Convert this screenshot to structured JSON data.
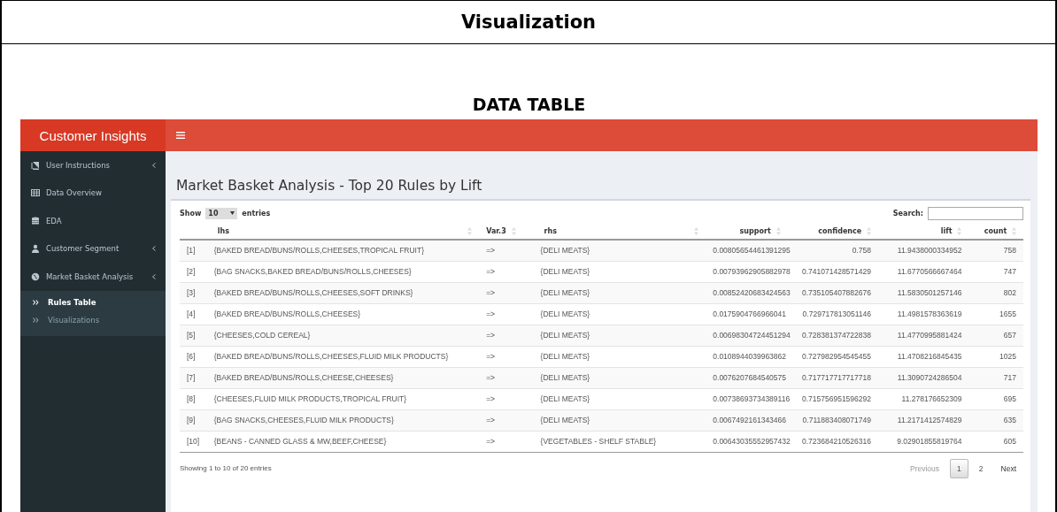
{
  "document": {
    "heading": "Visualization",
    "subheading": "DATA TABLE"
  },
  "app": {
    "brand": "Customer Insights",
    "sidebar": [
      {
        "label": "User Instructions",
        "expandable": true
      },
      {
        "label": "Data Overview",
        "expandable": false
      },
      {
        "label": "EDA",
        "expandable": false
      },
      {
        "label": "Customer Segment",
        "expandable": true
      },
      {
        "label": "Market Basket Analysis",
        "expandable": true,
        "children": [
          {
            "label": "Rules Table",
            "selected": true
          },
          {
            "label": "Visualizations",
            "selected": false
          }
        ]
      }
    ],
    "page_title": "Market Basket Analysis - Top 20 Rules by Lift",
    "length_menu": {
      "before": "Show",
      "value": "10",
      "after": "entries"
    },
    "search": {
      "label": "Search:"
    },
    "columns": [
      null,
      "lhs",
      "Var.3",
      "rhs",
      "support",
      "confidence",
      "lift",
      "count"
    ],
    "rows": [
      [
        "[1]",
        "{BAKED BREAD/BUNS/ROLLS,CHEESES,TROPICAL FRUIT}",
        "=>",
        "{DELI MEATS}",
        "0.00805654461391295",
        "0.758",
        "11.9438000334952",
        "758"
      ],
      [
        "[2]",
        "{BAG SNACKS,BAKED BREAD/BUNS/ROLLS,CHEESES}",
        "=>",
        "{DELI MEATS}",
        "0.00793962905882978",
        "0.741071428571429",
        "11.6770566667464",
        "747"
      ],
      [
        "[3]",
        "{BAKED BREAD/BUNS/ROLLS,CHEESES,SOFT DRINKS}",
        "=>",
        "{DELI MEATS}",
        "0.00852420683424563",
        "0.735105407882676",
        "11.5830501257146",
        "802"
      ],
      [
        "[4]",
        "{BAKED BREAD/BUNS/ROLLS,CHEESES}",
        "=>",
        "{DELI MEATS}",
        "0.0175904766966041",
        "0.729717813051146",
        "11.4981578363619",
        "1655"
      ],
      [
        "[5]",
        "{CHEESES,COLD CEREAL}",
        "=>",
        "{DELI MEATS}",
        "0.00698304724451294",
        "0.728381374722838",
        "11.4770995881424",
        "657"
      ],
      [
        "[6]",
        "{BAKED BREAD/BUNS/ROLLS,CHEESES,FLUID MILK PRODUCTS}",
        "=>",
        "{DELI MEATS}",
        "0.0108944039963862",
        "0.727982954545455",
        "11.4708216845435",
        "1025"
      ],
      [
        "[7]",
        "{BAKED BREAD/BUNS/ROLLS,CHEESE,CHEESES}",
        "=>",
        "{DELI MEATS}",
        "0.0076207684540575",
        "0.717717717717718",
        "11.3090724286504",
        "717"
      ],
      [
        "[8]",
        "{CHEESES,FLUID MILK PRODUCTS,TROPICAL FRUIT}",
        "=>",
        "{DELI MEATS}",
        "0.00738693734389116",
        "0.715756951596292",
        "11.278176652309",
        "695"
      ],
      [
        "[9]",
        "{BAG SNACKS,CHEESES,FLUID MILK PRODUCTS}",
        "=>",
        "{DELI MEATS}",
        "0.0067492161343466",
        "0.711883408071749",
        "11.2171412574829",
        "635"
      ],
      [
        "[10]",
        "{BEANS - CANNED GLASS & MW,BEEF,CHEESE}",
        "=>",
        "{VEGETABLES - SHELF STABLE}",
        "0.00643035552957432",
        "0.723684210526316",
        "9.02901855819764",
        "605"
      ]
    ],
    "info": "Showing 1 to 10 of 20 entries",
    "pagination": [
      {
        "label": "Previous",
        "kind": "nav",
        "selected": false
      },
      {
        "label": "1",
        "kind": "page",
        "selected": true
      },
      {
        "label": "2",
        "kind": "page",
        "selected": false
      },
      {
        "label": "Next",
        "kind": "nav",
        "selected": false
      }
    ]
  }
}
